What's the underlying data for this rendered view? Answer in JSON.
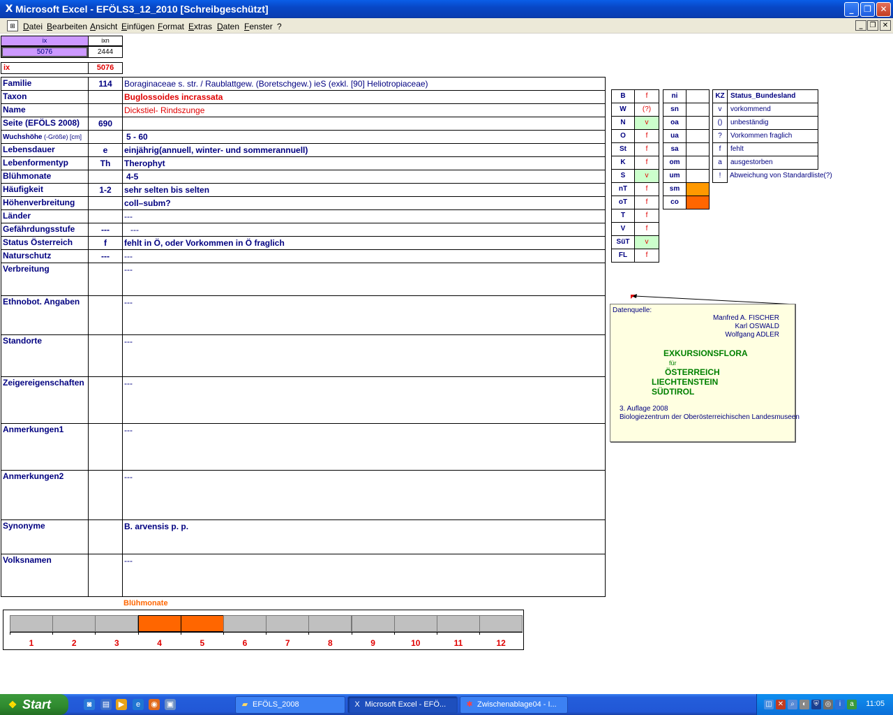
{
  "window": {
    "title": "Microsoft Excel - EFÖLS3_12_2010  [Schreibgeschützt]",
    "minimize": "_",
    "restore": "❐",
    "close": "✕"
  },
  "menu": {
    "items": [
      "Datei",
      "Bearbeiten",
      "Ansicht",
      "Einfügen",
      "Format",
      "Extras",
      "Daten",
      "Fenster",
      "?"
    ],
    "mdi_minimize": "_",
    "mdi_restore": "❐",
    "mdi_close": "✕"
  },
  "top": {
    "ix_label": "ix",
    "ixn_label": "ixn",
    "ix_value": "5076",
    "ixn_value": "2444",
    "ix_red_label": "ix",
    "ix_red_value": "5076"
  },
  "rows": [
    {
      "label": "Familie",
      "code": "114",
      "value": "Boraginaceae s. str.  /  Raublattgew. (Boretschgew.) ieS (exkl. [90] Heliotropiaceae)"
    },
    {
      "label": "Taxon",
      "code": "",
      "value": "Buglossoides incrassata"
    },
    {
      "label": "Name",
      "code": "",
      "value": "Dickstiel- Rindszunge"
    },
    {
      "label": "Seite (EFÖLS 2008)",
      "code": "690",
      "value": ""
    },
    {
      "label": "Wuchshöhe",
      "label_suffix": " (-Größe) [cm]",
      "code": "",
      "value": "5 - 60"
    },
    {
      "label": "Lebensdauer",
      "code": "e",
      "value": "einjährig(annuell, winter- und sommerannuell)"
    },
    {
      "label": "Lebenformentyp",
      "code": "Th",
      "value": "Therophyt"
    },
    {
      "label": "Blühmonate",
      "code": "",
      "value": "4-5"
    },
    {
      "label": "Häufigkeit",
      "code": "1-2",
      "value": "sehr selten bis selten"
    },
    {
      "label": "Höhenverbreitung",
      "code": "",
      "value": "coll–subm?"
    },
    {
      "label": "Länder",
      "code": "",
      "value": "---"
    },
    {
      "label": "Gefährdungsstufe",
      "code": "---",
      "value": "---"
    },
    {
      "label": "Status Österreich",
      "code": "f",
      "value": "fehlt in Ö, oder Vorkommen in Ö fraglich"
    },
    {
      "label": "Naturschutz",
      "code": "---",
      "value": "---"
    },
    {
      "label": "Verbreitung",
      "code": "",
      "value": "---"
    },
    {
      "label": "Ethnobot. Angaben",
      "code": "",
      "value": "---"
    },
    {
      "label": "Standorte",
      "code": "",
      "value": "---"
    },
    {
      "label": "Zeigereigenschaften",
      "code": "",
      "value": "---"
    },
    {
      "label": "Anmerkungen1",
      "code": "",
      "value": "---"
    },
    {
      "label": "Anmerkungen2",
      "code": "",
      "value": "---"
    },
    {
      "label": "Synonyme",
      "code": "",
      "value": "B. arvensis p. p."
    },
    {
      "label": "Volksnamen",
      "code": "",
      "value": "---"
    }
  ],
  "states": [
    {
      "k": "B",
      "v": "f"
    },
    {
      "k": "W",
      "v": "(?)"
    },
    {
      "k": "N",
      "v": "v"
    },
    {
      "k": "O",
      "v": "f"
    },
    {
      "k": "St",
      "v": "f"
    },
    {
      "k": "K",
      "v": "f"
    },
    {
      "k": "S",
      "v": "v"
    },
    {
      "k": "nT",
      "v": "f"
    },
    {
      "k": "oT",
      "v": "f"
    },
    {
      "k": "T",
      "v": "f"
    },
    {
      "k": "V",
      "v": "f"
    },
    {
      "k": "SüT",
      "v": "v"
    },
    {
      "k": "FL",
      "v": "f"
    }
  ],
  "zones": [
    {
      "k": "ni",
      "v": ""
    },
    {
      "k": "sn",
      "v": ""
    },
    {
      "k": "oa",
      "v": ""
    },
    {
      "k": "ua",
      "v": ""
    },
    {
      "k": "sa",
      "v": ""
    },
    {
      "k": "om",
      "v": ""
    },
    {
      "k": "um",
      "v": ""
    },
    {
      "k": "sm",
      "v": ""
    },
    {
      "k": "co",
      "v": ""
    }
  ],
  "legend": {
    "header_code": "KZ",
    "header_text": "Status_Bundesland",
    "items": [
      {
        "code": "v",
        "text": "vorkommend"
      },
      {
        "code": "()",
        "text": "unbeständig"
      },
      {
        "code": "?",
        "text": "Vorkommen fraglich"
      },
      {
        "code": "f",
        "text": "fehlt"
      },
      {
        "code": "a",
        "text": "ausgestorben"
      },
      {
        "code": "!",
        "text": "Abweichung von Standardliste(?)"
      }
    ]
  },
  "source": {
    "heading": "Datenquelle:",
    "author1": "Manfred A. FISCHER",
    "author2": "Karl OSWALD",
    "author3": "Wolfgang ADLER",
    "book_title": "EXKURSIONSFLORA",
    "fuer": "für",
    "country1": "ÖSTERREICH",
    "country2": "LIECHTENSTEIN",
    "country3": "SÜDTIROL",
    "edition": "3. Auflage 2008",
    "publisher": "Biologiezentrum der Oberösterreichischen Landesmuseen"
  },
  "months": {
    "title": "Blühmonate",
    "labels": [
      "1",
      "2",
      "3",
      "4",
      "5",
      "6",
      "7",
      "8",
      "9",
      "10",
      "11",
      "12"
    ],
    "active": [
      4,
      5
    ]
  },
  "colors": {
    "present_green": "#ccffcc",
    "active_orange": "#ff6600",
    "zone_sm_orange": "#ff9900",
    "ix_lavender": "#cc99ff"
  },
  "taskbar": {
    "start": "Start",
    "tasks": [
      "EFÖLS_2008",
      "Microsoft Excel - EFÖ...",
      "Zwischenablage04 - I..."
    ],
    "clock": "11:05"
  }
}
